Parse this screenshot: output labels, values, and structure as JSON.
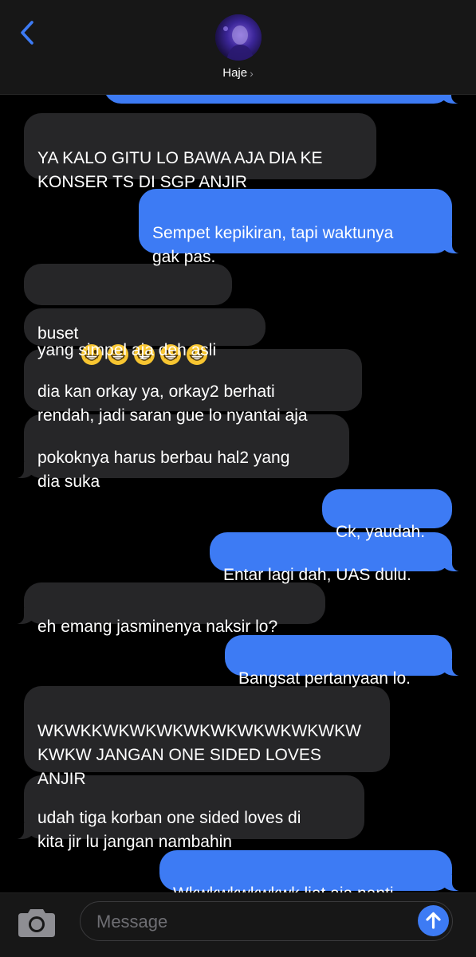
{
  "header": {
    "contact_name": "Haje",
    "chevron": "›",
    "back_icon": "chevron-left-icon",
    "avatar_icon": "contact-avatar"
  },
  "colors": {
    "sent_bubble": "#3d7bf4",
    "received_bubble": "#262628",
    "accent": "#3d7bf4",
    "background": "#000000"
  },
  "messages": [
    {
      "direction": "received",
      "text": "YA KALO GITU LO BAWA AJA DIA KE\nKONSER TS DI SGP ANJIR"
    },
    {
      "direction": "sent",
      "text": "Sempet kepikiran, tapi waktunya\ngak pas."
    },
    {
      "direction": "received",
      "text": "buset",
      "emoji": [
        "😁",
        "😁",
        "😁",
        "😁",
        "😁"
      ],
      "emoji_name": "grinning-face-icon"
    },
    {
      "direction": "received",
      "text": "yang simpel aja deh asli"
    },
    {
      "direction": "received",
      "text": "dia kan orkay ya, orkay2 berhati\nrendah, jadi saran gue lo nyantai aja"
    },
    {
      "direction": "received",
      "text": "pokoknya harus berbau hal2 yang\ndia suka"
    },
    {
      "direction": "sent",
      "text": "Ck, yaudah."
    },
    {
      "direction": "sent",
      "text": "Entar lagi dah, UAS dulu."
    },
    {
      "direction": "received",
      "text": "eh emang jasminenya naksir lo?"
    },
    {
      "direction": "sent",
      "text": "Bangsat pertanyaan lo."
    },
    {
      "direction": "received",
      "text": "WKWKKWKWKWKWKWKWKWKWKWKW\nKWKW JANGAN ONE SIDED LOVES\nANJIR"
    },
    {
      "direction": "received",
      "text": "udah tiga korban one sided loves di\nkita jir lu jangan nambahin"
    },
    {
      "direction": "sent",
      "text": "Wkwkwkwkwkwk liat aja nanti."
    }
  ],
  "composer": {
    "placeholder": "Message",
    "value": "",
    "camera_icon": "camera-icon",
    "send_icon": "arrow-up-icon"
  }
}
